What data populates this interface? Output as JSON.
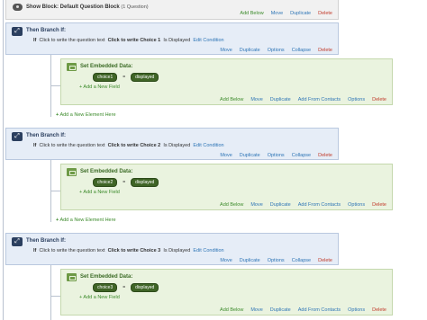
{
  "show_block": {
    "title": "Show Block: Default Question Block",
    "sub": "(1 Question)",
    "actions": {
      "add_below": "Add Below",
      "move": "Move",
      "duplicate": "Duplicate",
      "delete": "Delete"
    }
  },
  "branches": [
    {
      "title": "Then Branch If:",
      "cond_if": "If",
      "cond_text": "Click to write the question text",
      "cond_choice": "Click to write Choice 1",
      "cond_is": "Is Displayed",
      "edit": "Edit Condition",
      "actions": {
        "move": "Move",
        "duplicate": "Duplicate",
        "options": "Options",
        "collapse": "Collapse",
        "delete": "Delete"
      },
      "embed": {
        "title": "Set Embedded Data:",
        "field": "choice1",
        "eq": "=",
        "value": "displayed",
        "add_field": "+ Add a New Field",
        "actions": {
          "add_below": "Add Below",
          "move": "Move",
          "duplicate": "Duplicate",
          "add_from_contacts": "Add From Contacts",
          "options": "Options",
          "delete": "Delete"
        }
      },
      "add_element": "Add a New Element Here"
    },
    {
      "title": "Then Branch If:",
      "cond_if": "If",
      "cond_text": "Click to write the question text",
      "cond_choice": "Click to write Choice 2",
      "cond_is": "Is Displayed",
      "edit": "Edit Condition",
      "actions": {
        "move": "Move",
        "duplicate": "Duplicate",
        "options": "Options",
        "collapse": "Collapse",
        "delete": "Delete"
      },
      "embed": {
        "title": "Set Embedded Data:",
        "field": "choice2",
        "eq": "=",
        "value": "displayed",
        "add_field": "+ Add a New Field",
        "actions": {
          "add_below": "Add Below",
          "move": "Move",
          "duplicate": "Duplicate",
          "add_from_contacts": "Add From Contacts",
          "options": "Options",
          "delete": "Delete"
        }
      },
      "add_element": "Add a New Element Here"
    },
    {
      "title": "Then Branch If:",
      "cond_if": "If",
      "cond_text": "Click to write the question text",
      "cond_choice": "Click to write Choice 3",
      "cond_is": "Is Displayed",
      "edit": "Edit Condition",
      "actions": {
        "move": "Move",
        "duplicate": "Duplicate",
        "options": "Options",
        "collapse": "Collapse",
        "delete": "Delete"
      },
      "embed": {
        "title": "Set Embedded Data:",
        "field": "choice3",
        "eq": "=",
        "value": "displayed",
        "add_field": "+ Add a New Field",
        "actions": {
          "add_below": "Add Below",
          "move": "Move",
          "duplicate": "Duplicate",
          "add_from_contacts": "Add From Contacts",
          "options": "Options",
          "delete": "Delete"
        }
      }
    }
  ]
}
